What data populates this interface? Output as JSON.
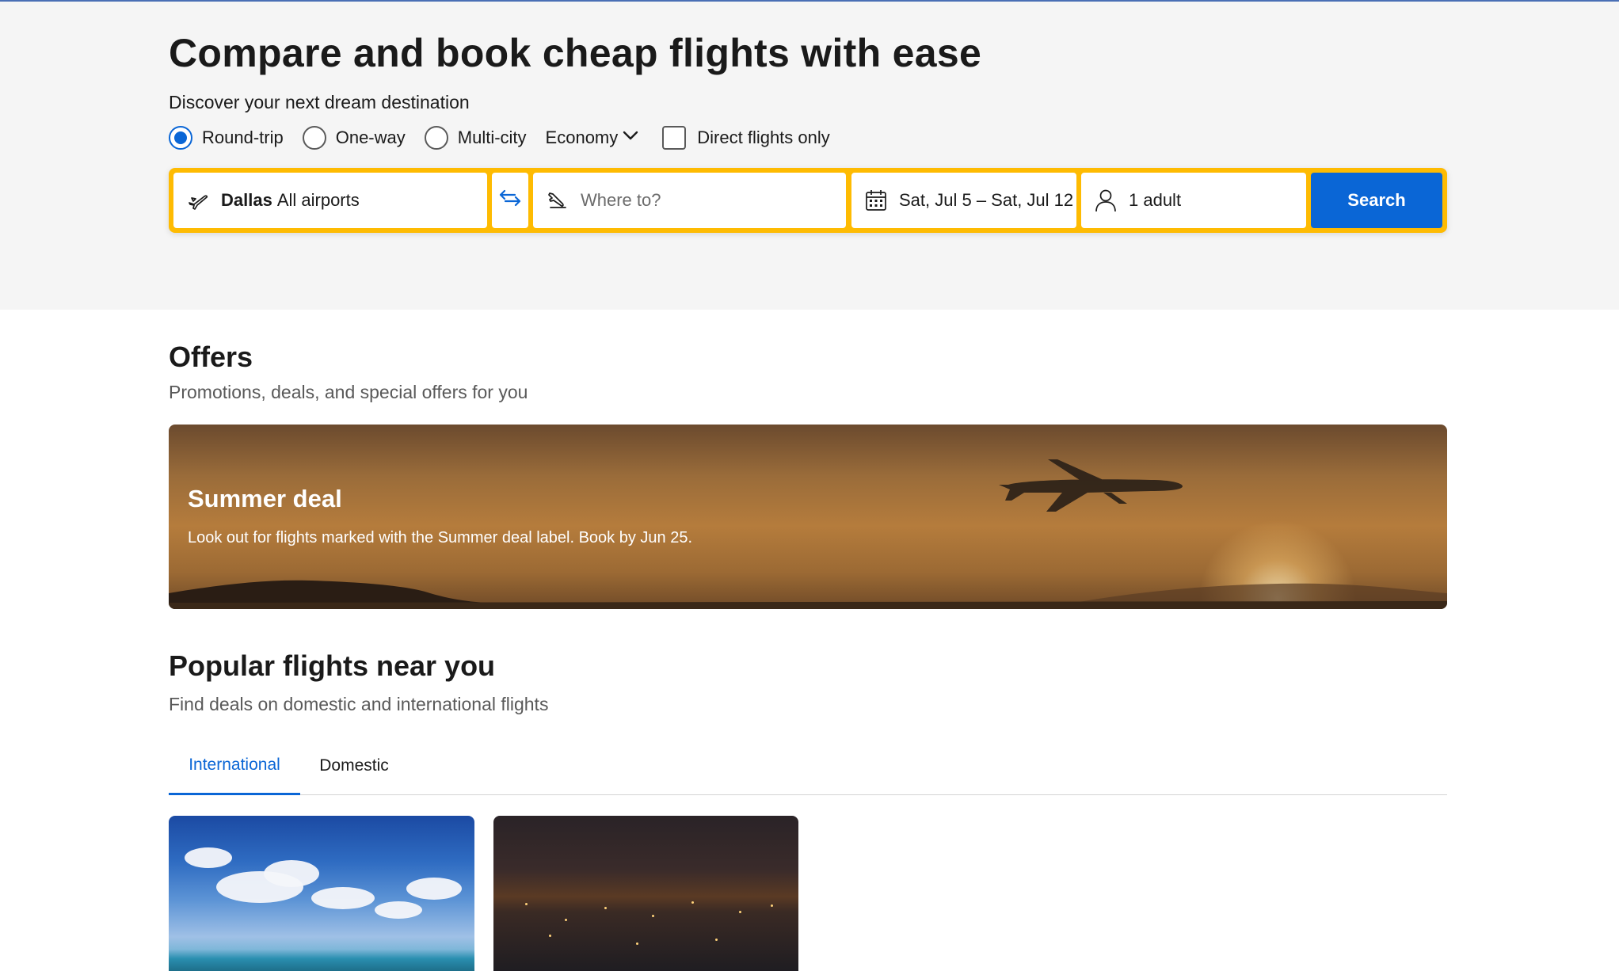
{
  "hero": {
    "title": "Compare and book cheap flights with ease",
    "subtitle": "Discover your next dream destination",
    "trip_types": [
      {
        "label": "Round-trip",
        "selected": true
      },
      {
        "label": "One-way",
        "selected": false
      },
      {
        "label": "Multi-city",
        "selected": false
      }
    ],
    "cabin_class": "Economy",
    "direct_only_label": "Direct flights only",
    "direct_only_checked": false
  },
  "search": {
    "from_city": "Dallas",
    "from_airports": "All airports",
    "to_placeholder": "Where to?",
    "dates": "Sat, Jul 5 – Sat, Jul 12",
    "travelers": "1 adult",
    "button_label": "Search",
    "accent_color": "#febb02",
    "button_color": "#0a66d6"
  },
  "offers": {
    "title": "Offers",
    "subtitle": "Promotions, deals, and special offers for you",
    "banner": {
      "title": "Summer deal",
      "text": "Look out for flights marked with the Summer deal label. Book by Jun 25."
    }
  },
  "popular": {
    "title": "Popular flights near you",
    "subtitle": "Find deals on domestic and international flights",
    "tabs": [
      {
        "label": "International",
        "active": true
      },
      {
        "label": "Domestic",
        "active": false
      }
    ]
  }
}
